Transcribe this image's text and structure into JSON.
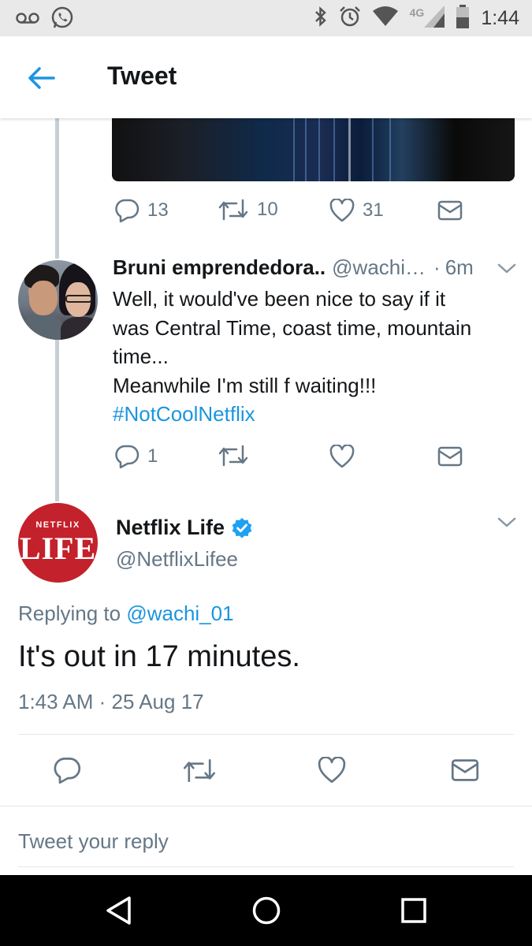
{
  "status_bar": {
    "left_icons": [
      "voicemail-icon",
      "whatsapp-icon"
    ],
    "right_icons": [
      "bluetooth-icon",
      "alarm-icon",
      "wifi-icon",
      "signal-icon",
      "battery-icon"
    ],
    "network": "4G",
    "time": "1:44"
  },
  "header": {
    "title": "Tweet",
    "back_icon": "back-arrow-icon"
  },
  "previous_tweet": {
    "reply_count": "13",
    "retweet_count": "10",
    "like_count": "31"
  },
  "reply_tweet": {
    "display_name": "Bruni emprendedora..",
    "handle": "@wachi…",
    "separator": "·",
    "time": "6m",
    "body_lines": [
      "Well, it would've been nice to say if it",
      "was Central Time, coast time, mountain",
      "time...",
      "Meanwhile I'm still f waiting!!!"
    ],
    "hashtag": "#NotCoolNetflix",
    "reply_count": "1"
  },
  "main_tweet": {
    "display_name": "Netflix Life",
    "handle": "@NetflixLifee",
    "avatar_small_text": "NETFLIX",
    "avatar_big_text": "LIFE",
    "replying_prefix": "Replying to ",
    "replying_to": "@wachi_01",
    "text": "It's out in 17 minutes.",
    "timestamp": "1:43 AM · 25 Aug 17"
  },
  "reply_box": {
    "placeholder": "Tweet your reply"
  },
  "colors": {
    "accent": "#1b95e0",
    "secondary_text": "#657786",
    "primary_text": "#14171a",
    "verified": "#1da1f2",
    "netflix_red": "#c3212b"
  }
}
